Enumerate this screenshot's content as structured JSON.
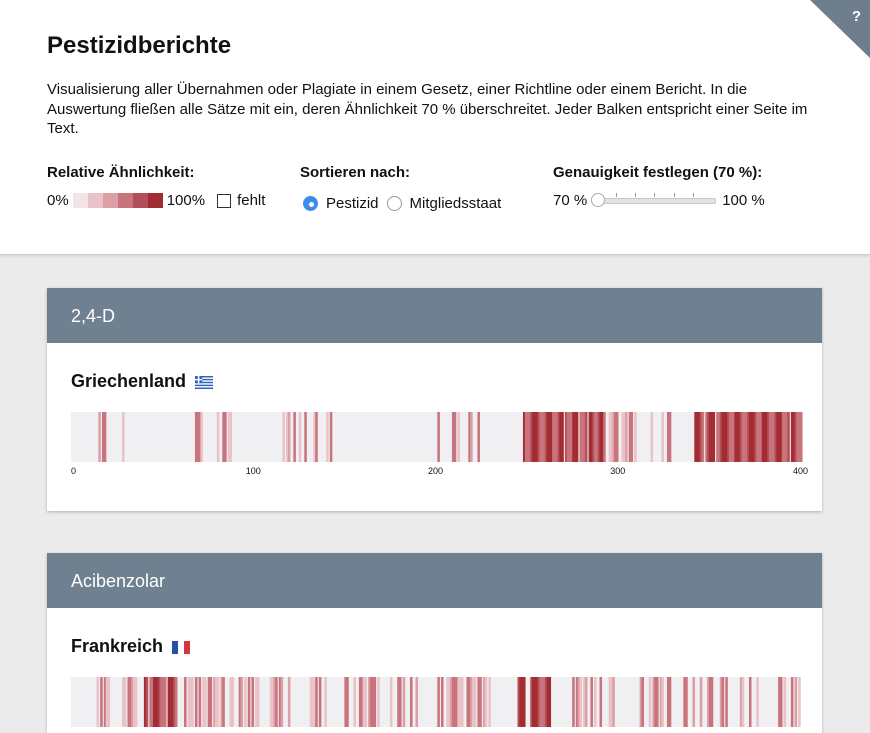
{
  "page": {
    "title": "Pestizidberichte",
    "intro": "Visualisierung aller Übernahmen oder Plagiate in einem Gesetz, einer Richtline oder einem Bericht. In die Auswertung fließen alle Sätze mit ein, deren Ähnlichkeit 70 % überschreitet. Jeder Balken entspricht einer Seite im Text.",
    "help_label": "?"
  },
  "legend": {
    "title": "Relative Ähnlichkeit:",
    "min_label": "0%",
    "max_label": "100%",
    "missing_label": "fehlt",
    "colors": [
      "#f3e4e6",
      "#e9c3c7",
      "#dba0a6",
      "#c9747c",
      "#b24f58",
      "#a32c33"
    ]
  },
  "sort": {
    "title": "Sortieren nach:",
    "options": [
      {
        "label": "Pestizid",
        "selected": true
      },
      {
        "label": "Mitgliedsstaat",
        "selected": false
      }
    ]
  },
  "accuracy": {
    "title": "Genauigkeit festlegen (70 %):",
    "min_label": "70 %",
    "max_label": "100 %",
    "value_percent": 70
  },
  "cards": [
    {
      "pesticide": "2,4-D",
      "country": "Griechenland",
      "flag": "greece-flag-icon",
      "axis": {
        "min": 0,
        "max": 400,
        "ticks": [
          "0",
          "100",
          "200",
          "300",
          "400"
        ]
      }
    },
    {
      "pesticide": "Acibenzolar",
      "country": "Frankreich",
      "flag": "france-flag-icon"
    }
  ],
  "colors": {
    "card_header": "#6f8090",
    "bar_background": "#f0f0f3",
    "accent_blue": "#3b8ee8"
  }
}
